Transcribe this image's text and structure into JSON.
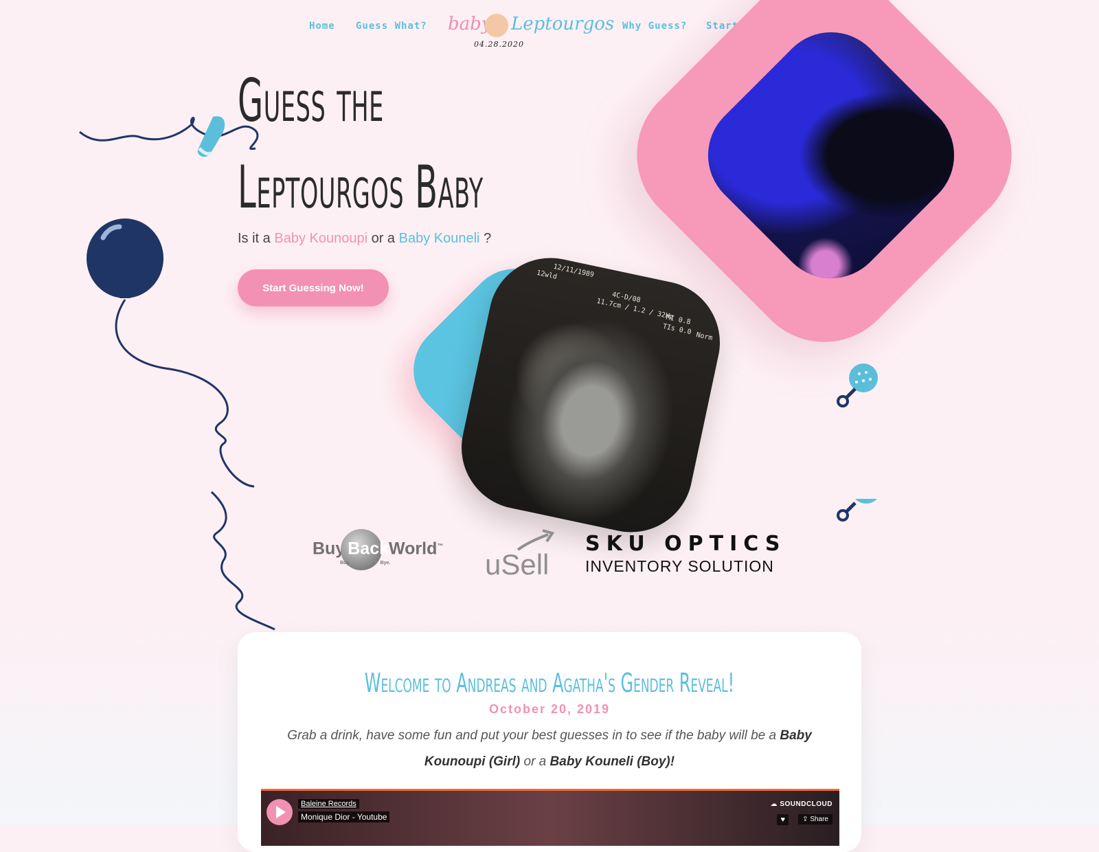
{
  "nav": {
    "items": [
      "Home",
      "Guess What?",
      "Why Guess?",
      "Start Guessing"
    ],
    "logo_left": "baby",
    "logo_right": "Leptourgos",
    "logo_date": "04.28.2020"
  },
  "hero": {
    "title_line1": "Guess the",
    "title_line2": "Leptourgos Baby",
    "subtitle_pre": "Is it a",
    "subtitle_girl": "Baby Kounoupi",
    "subtitle_mid": "or a",
    "subtitle_boy": "Baby Kouneli",
    "subtitle_post": "?",
    "cta": "Start Guessing Now!"
  },
  "ultrasound": {
    "date": "12/11/1989",
    "week": "12wld",
    "probe": "4C-D/08",
    "params": "11.7cm / 1.2 / 32Hz",
    "mi": "MI 0.8",
    "tis": "TIs 0.0",
    "mode": "Norm"
  },
  "sponsors": {
    "bbw_buy": "Buy",
    "bbw_back": "Back",
    "bbw_world": "World",
    "bbw_tm": "™",
    "bbw_tag1": "Buy.",
    "bbw_tag2": "Bye.",
    "usell": "uSell",
    "sku_line1": "SKU OPTICS",
    "sku_line2": "INVENTORY SOLUTION"
  },
  "welcome": {
    "title": "Welcome to Andreas and Agatha's Gender Reveal!",
    "date": "October 20, 2019",
    "text_pre": "Grab a drink, have some fun and put your best guesses in to see if the baby will be a",
    "text_girl": "Baby Kounoupi (Girl)",
    "text_mid": "or a",
    "text_boy": "Baby Kouneli (Boy)!"
  },
  "player": {
    "artist": "Baleine Records",
    "track": "Monique Dior - Youtube",
    "brand": "SOUNDCLOUD",
    "share": "Share"
  },
  "colors": {
    "pink": "#f291b3",
    "blue": "#5bbfdc",
    "navy": "#1f3566",
    "background": "#fdf0f4"
  }
}
